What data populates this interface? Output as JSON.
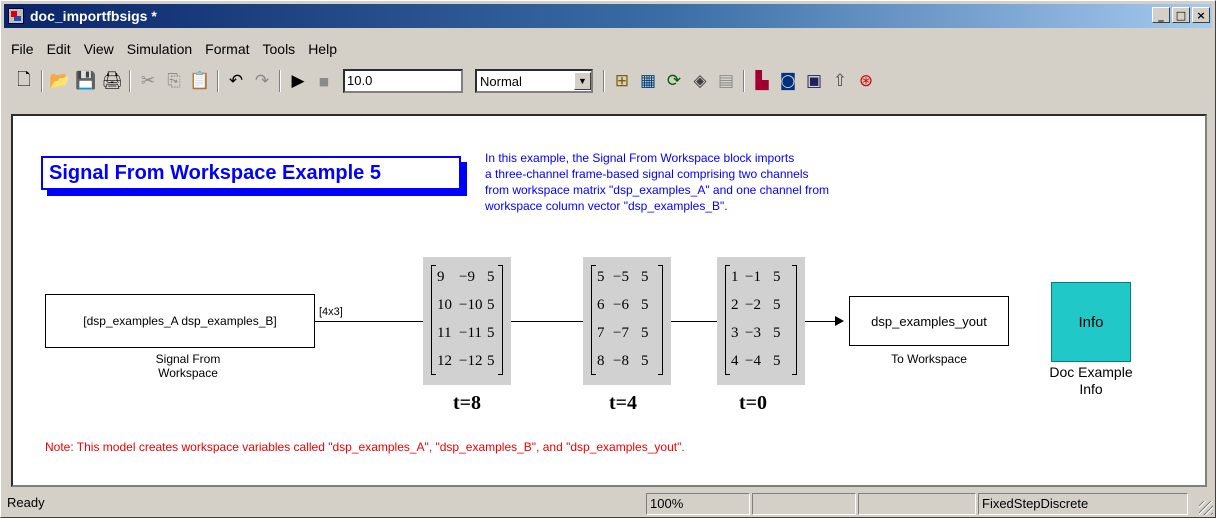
{
  "window": {
    "title": "doc_importfbsigs *"
  },
  "titlebar_buttons": {
    "minimize": "_",
    "maximize": "□",
    "close": "×"
  },
  "menu": [
    "File",
    "Edit",
    "View",
    "Simulation",
    "Format",
    "Tools",
    "Help"
  ],
  "toolbar": {
    "stop_time": "10.0",
    "sim_mode": "Normal",
    "icons": [
      "new-icon",
      "open-icon",
      "save-icon",
      "print-icon",
      "cut-icon",
      "copy-icon",
      "paste-icon",
      "undo-icon",
      "redo-icon",
      "run-icon",
      "stop-icon",
      "build-icon",
      "debug-icon",
      "update-icon",
      "library-icon",
      "model-explorer-icon",
      "explorer-icon",
      "print-preview-icon",
      "up-arrow-icon",
      "simulink-icon"
    ]
  },
  "diagram": {
    "title": "Signal From Workspace Example 5",
    "description": [
      "In this example, the Signal From Workspace block imports",
      "a three-channel frame-based signal comprising two channels",
      "from workspace matrix \"dsp_examples_A\" and one channel from",
      "workspace column vector \"dsp_examples_B\"."
    ],
    "source_block": {
      "text": "[dsp_examples_A dsp_examples_B]",
      "label_line1": "Signal From",
      "label_line2": "Workspace"
    },
    "signal_dim": "[4x3]",
    "matrices": [
      {
        "time": "t=8",
        "rows": [
          [
            "9",
            "−9",
            "5"
          ],
          [
            "10",
            "−10",
            "5"
          ],
          [
            "11",
            "−11",
            "5"
          ],
          [
            "12",
            "−12",
            "5"
          ]
        ]
      },
      {
        "time": "t=4",
        "rows": [
          [
            "5",
            "−5",
            "5"
          ],
          [
            "6",
            "−6",
            "5"
          ],
          [
            "7",
            "−7",
            "5"
          ],
          [
            "8",
            "−8",
            "5"
          ]
        ]
      },
      {
        "time": "t=0",
        "rows": [
          [
            "1",
            "−1",
            "5"
          ],
          [
            "2",
            "−2",
            "5"
          ],
          [
            "3",
            "−3",
            "5"
          ],
          [
            "4",
            "−4",
            "5"
          ]
        ]
      }
    ],
    "sink_block": {
      "text": "dsp_examples_yout",
      "label": "To Workspace"
    },
    "info_block": {
      "text": "Info",
      "label_line1": "Doc Example",
      "label_line2": "Info"
    },
    "note": "Note: This model creates workspace variables called \"dsp_examples_A\", \"dsp_examples_B\", and \"dsp_examples_yout\"."
  },
  "status": {
    "left": "Ready",
    "zoom": "100%",
    "solver": "FixedStepDiscrete"
  },
  "colors": {
    "title_blue": "#0000ff",
    "note_red": "#ee0000",
    "info_cyan": "#20c8c8",
    "matrix_gray": "#d1d1d1"
  }
}
